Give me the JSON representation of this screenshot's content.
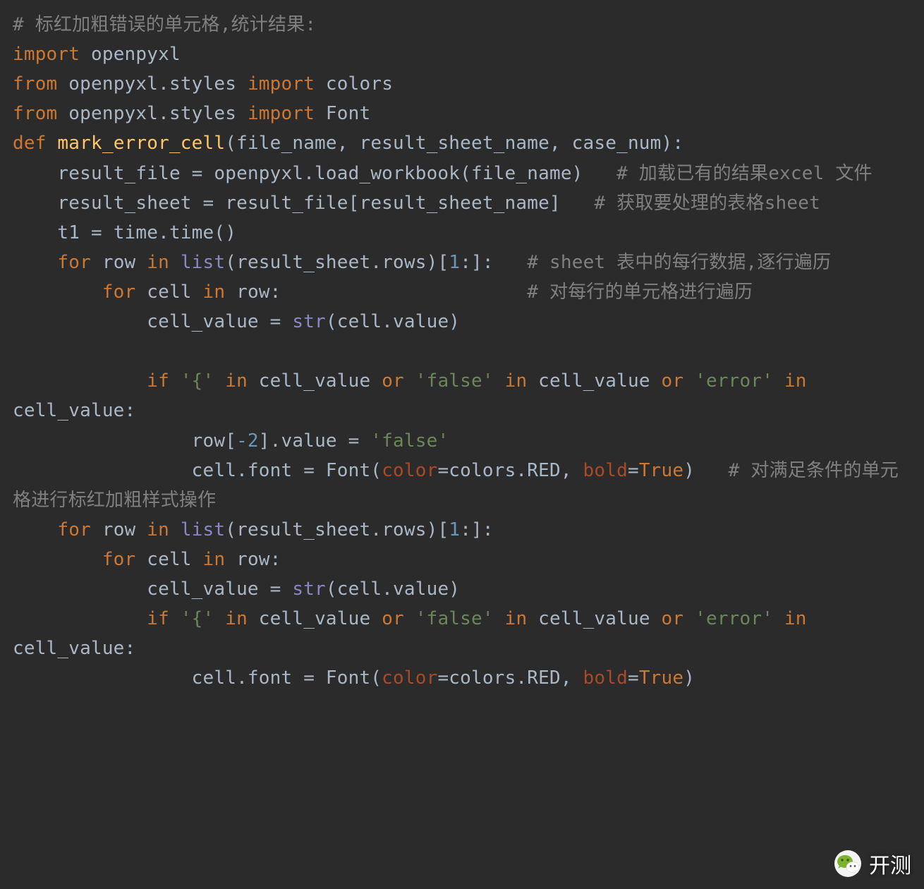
{
  "code": {
    "lines": [
      {
        "segments": [
          {
            "cls": "c-comment",
            "text": "# 标红加粗错误的单元格,统计结果:"
          }
        ]
      },
      {
        "segments": [
          {
            "cls": "c-keyword",
            "text": "import "
          },
          {
            "cls": "c-plain",
            "text": "openpyxl"
          }
        ]
      },
      {
        "segments": [
          {
            "cls": "c-keyword",
            "text": "from "
          },
          {
            "cls": "c-plain",
            "text": "openpyxl.styles "
          },
          {
            "cls": "c-keyword",
            "text": "import "
          },
          {
            "cls": "c-plain",
            "text": "colors"
          }
        ]
      },
      {
        "segments": [
          {
            "cls": "c-keyword",
            "text": "from "
          },
          {
            "cls": "c-plain",
            "text": "openpyxl.styles "
          },
          {
            "cls": "c-keyword",
            "text": "import "
          },
          {
            "cls": "c-plain",
            "text": "Font"
          }
        ]
      },
      {
        "segments": [
          {
            "cls": "c-def",
            "text": "def "
          },
          {
            "cls": "c-funcname",
            "text": "mark_error_cell"
          },
          {
            "cls": "c-plain",
            "text": "(file_name, result_sheet_name, case_num):"
          }
        ]
      },
      {
        "segments": [
          {
            "cls": "c-plain",
            "text": "    result_file = openpyxl.load_workbook(file_name)   "
          },
          {
            "cls": "c-comment",
            "text": "# 加载已有的结果excel 文件"
          }
        ]
      },
      {
        "segments": [
          {
            "cls": "c-plain",
            "text": "    result_sheet = result_file[result_sheet_name]   "
          },
          {
            "cls": "c-comment",
            "text": "# 获取要处理的表格sheet"
          }
        ]
      },
      {
        "segments": [
          {
            "cls": "c-plain",
            "text": "    t1 = time.time()"
          }
        ]
      },
      {
        "segments": [
          {
            "cls": "c-plain",
            "text": "    "
          },
          {
            "cls": "c-keyword",
            "text": "for "
          },
          {
            "cls": "c-plain",
            "text": "row "
          },
          {
            "cls": "c-keyword",
            "text": "in "
          },
          {
            "cls": "c-builtin",
            "text": "list"
          },
          {
            "cls": "c-plain",
            "text": "(result_sheet.rows)["
          },
          {
            "cls": "c-number",
            "text": "1"
          },
          {
            "cls": "c-plain",
            "text": ":]:   "
          },
          {
            "cls": "c-comment",
            "text": "# sheet 表中的每行数据,逐行遍历"
          }
        ]
      },
      {
        "segments": [
          {
            "cls": "c-plain",
            "text": "        "
          },
          {
            "cls": "c-keyword",
            "text": "for "
          },
          {
            "cls": "c-plain",
            "text": "cell "
          },
          {
            "cls": "c-keyword",
            "text": "in "
          },
          {
            "cls": "c-plain",
            "text": "row:                      "
          },
          {
            "cls": "c-comment",
            "text": "# 对每行的单元格进行遍历"
          }
        ]
      },
      {
        "segments": [
          {
            "cls": "c-plain",
            "text": "            cell_value = "
          },
          {
            "cls": "c-builtin",
            "text": "str"
          },
          {
            "cls": "c-plain",
            "text": "(cell.value)"
          }
        ]
      },
      {
        "segments": [
          {
            "cls": "c-plain",
            "text": ""
          }
        ]
      },
      {
        "segments": [
          {
            "cls": "c-plain",
            "text": "            "
          },
          {
            "cls": "c-keyword",
            "text": "if "
          },
          {
            "cls": "c-string",
            "text": "'{'"
          },
          {
            "cls": "c-plain",
            "text": " "
          },
          {
            "cls": "c-keyword",
            "text": "in "
          },
          {
            "cls": "c-plain",
            "text": "cell_value "
          },
          {
            "cls": "c-keyword",
            "text": "or "
          },
          {
            "cls": "c-string",
            "text": "'false'"
          },
          {
            "cls": "c-plain",
            "text": " "
          },
          {
            "cls": "c-keyword",
            "text": "in "
          },
          {
            "cls": "c-plain",
            "text": "cell_value "
          },
          {
            "cls": "c-keyword",
            "text": "or "
          },
          {
            "cls": "c-string",
            "text": "'error'"
          },
          {
            "cls": "c-plain",
            "text": " "
          },
          {
            "cls": "c-keyword",
            "text": "in "
          },
          {
            "cls": "c-plain",
            "text": "cell_value:"
          }
        ]
      },
      {
        "segments": [
          {
            "cls": "c-plain",
            "text": "                row["
          },
          {
            "cls": "c-number",
            "text": "-2"
          },
          {
            "cls": "c-plain",
            "text": "].value = "
          },
          {
            "cls": "c-string",
            "text": "'false'"
          }
        ]
      },
      {
        "segments": [
          {
            "cls": "c-plain",
            "text": "                cell.font = Font("
          },
          {
            "cls": "c-kwarg",
            "text": "color"
          },
          {
            "cls": "c-plain",
            "text": "=colors.RED, "
          },
          {
            "cls": "c-kwarg",
            "text": "bold"
          },
          {
            "cls": "c-plain",
            "text": "="
          },
          {
            "cls": "c-true",
            "text": "True"
          },
          {
            "cls": "c-plain",
            "text": ")   "
          },
          {
            "cls": "c-comment",
            "text": "# 对满足条件的单元格进行标红加粗样式操作"
          }
        ]
      },
      {
        "segments": [
          {
            "cls": "c-plain",
            "text": "    "
          },
          {
            "cls": "c-keyword",
            "text": "for "
          },
          {
            "cls": "c-plain",
            "text": "row "
          },
          {
            "cls": "c-keyword",
            "text": "in "
          },
          {
            "cls": "c-builtin",
            "text": "list"
          },
          {
            "cls": "c-plain",
            "text": "(result_sheet.rows)["
          },
          {
            "cls": "c-number",
            "text": "1"
          },
          {
            "cls": "c-plain",
            "text": ":]:"
          }
        ]
      },
      {
        "segments": [
          {
            "cls": "c-plain",
            "text": "        "
          },
          {
            "cls": "c-keyword",
            "text": "for "
          },
          {
            "cls": "c-plain",
            "text": "cell "
          },
          {
            "cls": "c-keyword",
            "text": "in "
          },
          {
            "cls": "c-plain",
            "text": "row:"
          }
        ]
      },
      {
        "segments": [
          {
            "cls": "c-plain",
            "text": "            cell_value = "
          },
          {
            "cls": "c-builtin",
            "text": "str"
          },
          {
            "cls": "c-plain",
            "text": "(cell.value)"
          }
        ]
      },
      {
        "segments": [
          {
            "cls": "c-plain",
            "text": "            "
          },
          {
            "cls": "c-keyword",
            "text": "if "
          },
          {
            "cls": "c-string",
            "text": "'{'"
          },
          {
            "cls": "c-plain",
            "text": " "
          },
          {
            "cls": "c-keyword",
            "text": "in "
          },
          {
            "cls": "c-plain",
            "text": "cell_value "
          },
          {
            "cls": "c-keyword",
            "text": "or "
          },
          {
            "cls": "c-string",
            "text": "'false'"
          },
          {
            "cls": "c-plain",
            "text": " "
          },
          {
            "cls": "c-keyword",
            "text": "in "
          },
          {
            "cls": "c-plain",
            "text": "cell_value "
          },
          {
            "cls": "c-keyword",
            "text": "or "
          },
          {
            "cls": "c-string",
            "text": "'error'"
          },
          {
            "cls": "c-plain",
            "text": " "
          },
          {
            "cls": "c-keyword",
            "text": "in "
          },
          {
            "cls": "c-plain",
            "text": "cell_value:"
          }
        ]
      },
      {
        "segments": [
          {
            "cls": "c-plain",
            "text": "                cell.font = Font("
          },
          {
            "cls": "c-kwarg",
            "text": "color"
          },
          {
            "cls": "c-plain",
            "text": "=colors.RED, "
          },
          {
            "cls": "c-kwarg",
            "text": "bold"
          },
          {
            "cls": "c-plain",
            "text": "="
          },
          {
            "cls": "c-true",
            "text": "True"
          },
          {
            "cls": "c-plain",
            "text": ")"
          }
        ]
      }
    ]
  },
  "watermark": {
    "label": "开测"
  }
}
